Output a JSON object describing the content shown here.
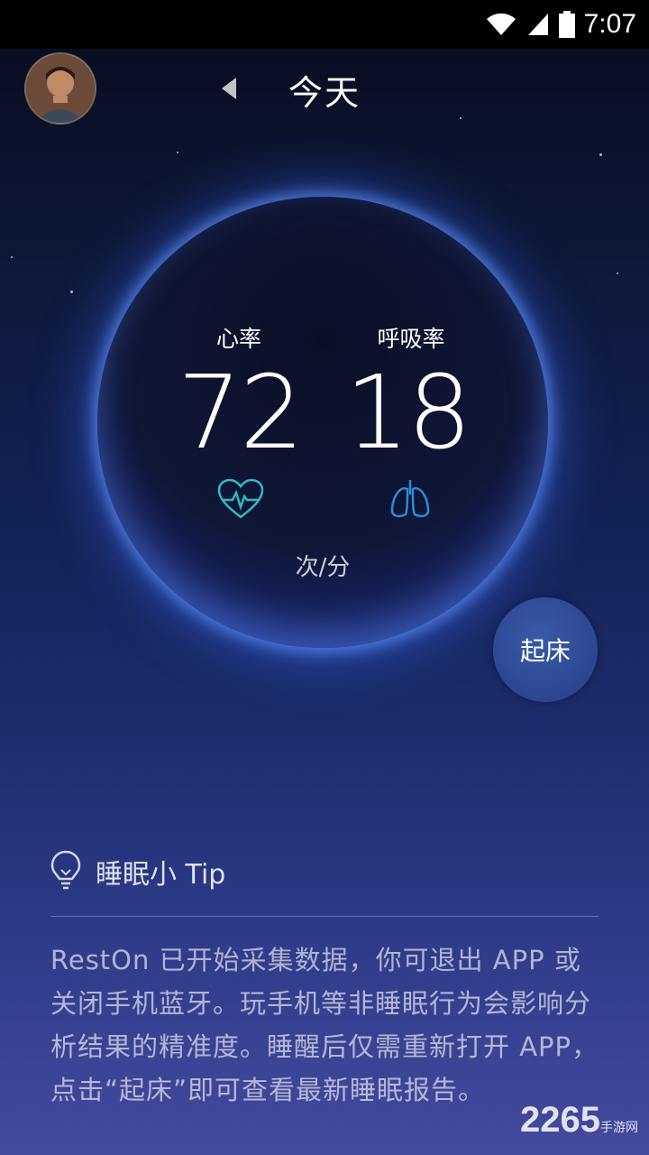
{
  "status_bar": {
    "time": "7:07",
    "icons": [
      "wifi-icon",
      "signal-icon",
      "battery-icon"
    ]
  },
  "header": {
    "title": "今天",
    "back_icon": "chevron-left-icon",
    "avatar": "user-avatar"
  },
  "metrics": {
    "heart_rate": {
      "label": "心率",
      "value": "72",
      "icon": "heart-pulse-icon"
    },
    "respiration_rate": {
      "label": "呼吸率",
      "value": "18",
      "icon": "lungs-icon"
    },
    "unit": "次/分"
  },
  "wake_button": {
    "label": "起床"
  },
  "tip": {
    "icon": "lightbulb-icon",
    "title": "睡眠小 Tip",
    "text": "RestOn 已开始采集数据，你可退出 APP 或关闭手机蓝牙。玩手机等非睡眠行为会影响分析结果的精准度。睡醒后仅需重新打开 APP，点击“起床”即可查看最新睡眠报告。"
  },
  "watermark": {
    "brand": "2265",
    "sub": "手游网"
  },
  "colors": {
    "accent_glow": "#3a6cff",
    "heart_icon": "#2fb8c8",
    "lungs_icon": "#2e8bd6"
  }
}
